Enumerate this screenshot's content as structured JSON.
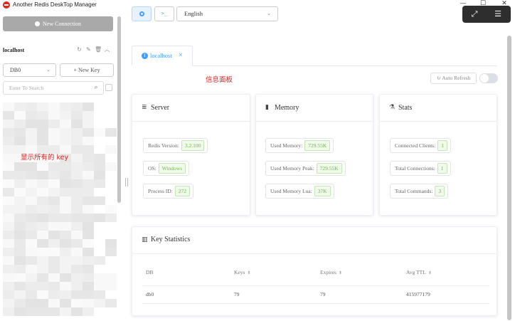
{
  "window": {
    "title": "Another Redis DeskTop Manager",
    "minimize_glyph": "—",
    "maximize_glyph": "☐",
    "close_glyph": "✕"
  },
  "overlay": {
    "expand_icon": "expand-icon",
    "expand_glyph": "⤢",
    "chat_icon": "chat-icon",
    "chat_glyph": "☰"
  },
  "sidebar": {
    "new_connection_label": "New Connection",
    "connection_name": "localhost",
    "connection_action_glyphs": {
      "refresh": "↻",
      "edit": "✎",
      "delete": "🗑",
      "collapse": "︿"
    },
    "db_select": {
      "value": "DB0",
      "chevron": "⌄"
    },
    "new_key_label": "+ New Key",
    "search": {
      "placeholder": "Enter To Search",
      "icon_glyph": "⌕"
    },
    "annotation": "显示所有的 key"
  },
  "toolbar": {
    "terminal_glyph": ">_",
    "language": {
      "value": "English",
      "chevron": "⌄"
    }
  },
  "tab": {
    "label": "localhost",
    "icon_glyph": "i",
    "close_glyph": "×"
  },
  "main_annotation": "信息面板",
  "auto_refresh_label": "↻ Auto Refresh",
  "cards": {
    "server": {
      "title": "Server",
      "icon_glyph": "≣",
      "items": [
        {
          "label": "Redis Version:",
          "value": "3.2.100"
        },
        {
          "label": "OS:",
          "value": "Windows"
        },
        {
          "label": "Process ID:",
          "value": "272"
        }
      ]
    },
    "memory": {
      "title": "Memory",
      "icon_glyph": "▮",
      "items": [
        {
          "label": "Used Memory:",
          "value": "729.55K"
        },
        {
          "label": "Used Memory Peak:",
          "value": "729.55K"
        },
        {
          "label": "Used Memory Lua:",
          "value": "37K"
        }
      ]
    },
    "stats": {
      "title": "Stats",
      "icon_glyph": "⚗",
      "items": [
        {
          "label": "Connected Clients:",
          "value": "1"
        },
        {
          "label": "Total Connections:",
          "value": "1"
        },
        {
          "label": "Total Commands:",
          "value": "3"
        }
      ]
    }
  },
  "key_statistics": {
    "title": "Key Statistics",
    "icon_glyph": "▥",
    "sort_glyph": "⬍",
    "columns": [
      "DB",
      "Keys",
      "Expires",
      "Avg TTL"
    ],
    "rows": [
      [
        "db0",
        "79",
        "79",
        "415977179"
      ]
    ]
  }
}
